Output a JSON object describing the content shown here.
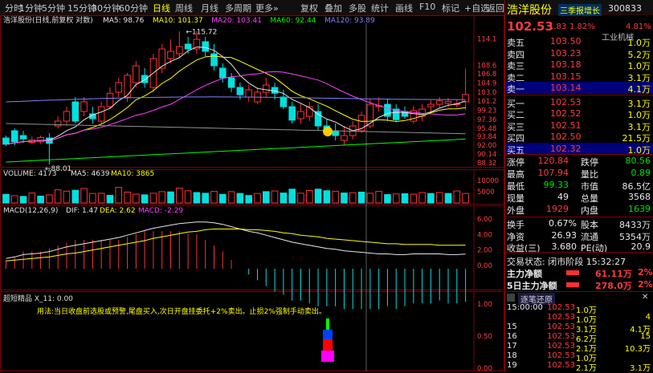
{
  "topbar": {
    "items": [
      "分时",
      "1分钟",
      "5分钟",
      "15分钟",
      "30分钟",
      "60分钟",
      "日线",
      "周线",
      "月线",
      "多周期",
      "更多»",
      "复权",
      "叠加",
      "多股",
      "统计",
      "画线",
      "F10",
      "标记",
      "+自选",
      "返回"
    ],
    "active": "日线"
  },
  "kline": {
    "title": "浩洋股份(日线,前复权 对数)",
    "ma": [
      {
        "label": "MA5: 98.76",
        "color": "#e8e8e8"
      },
      {
        "label": "MA10: 101.37",
        "color": "#ffff00"
      },
      {
        "label": "MA20: 103.41",
        "color": "#ff40ff"
      },
      {
        "label": "MA60: 92.44",
        "color": "#00ff00"
      },
      {
        "label": "MA120: 93.89",
        "color": "#8080ff"
      }
    ],
    "high_label": "115.72",
    "low_label": "88.01",
    "y_ticks": [
      "114.1",
      "108.6",
      "106.8",
      "104.9",
      "103.0",
      "101.2",
      "99.23",
      "97.36",
      "95.48",
      "93.84",
      "92.00",
      "90.14",
      "88.32"
    ],
    "ylim": [
      88.0,
      117.0
    ]
  },
  "volume": {
    "title": "VOLUME: 4173",
    "ma5": "MA5: 4639",
    "ma10": "MA10: 3865",
    "y_ticks": [
      "10000",
      "5000"
    ],
    "values": [
      3800,
      3200,
      2900,
      4400,
      3000,
      3600,
      5800,
      5200,
      5600,
      6400,
      4200,
      4300,
      3400,
      6900,
      4800,
      3900,
      3600,
      4300,
      5000,
      4900,
      6600,
      5400,
      4600,
      4300,
      5100,
      3800,
      5000,
      4200,
      3300,
      4200,
      5000,
      5300,
      4400,
      6100,
      4300,
      5500,
      6100,
      5400,
      5200,
      4400,
      4500,
      4800,
      4300,
      5100,
      3700,
      4000,
      4100,
      3900,
      4600,
      4200,
      4600,
      4200,
      5300,
      4200
    ],
    "colors": [
      "g",
      "r",
      "g",
      "r",
      "g",
      "r",
      "r",
      "r",
      "g",
      "r",
      "r",
      "r",
      "g",
      "r",
      "r",
      "r",
      "g",
      "r",
      "r",
      "g",
      "r",
      "r",
      "g",
      "g",
      "r",
      "g",
      "r",
      "g",
      "g",
      "r",
      "g",
      "r",
      "g",
      "g",
      "r",
      "r",
      "g",
      "g",
      "r",
      "g",
      "r",
      "g",
      "r",
      "r",
      "g",
      "r",
      "g",
      "r",
      "r",
      "g",
      "r",
      "g",
      "r",
      "r"
    ]
  },
  "macd": {
    "title": "MACD(12,26,9)",
    "dif": "DIF: 1.47",
    "dea": "DEA: 2.62",
    "macd": "MACD: -2.29",
    "y_ticks": [
      "6.00",
      "4.00",
      "2.00",
      "0.00"
    ],
    "dif_vals": [
      0.9,
      1.1,
      1.4,
      1.5,
      1.6,
      1.8,
      2.1,
      2.4,
      2.6,
      2.8,
      3.0,
      3.2,
      3.4,
      3.6,
      3.9,
      4.2,
      4.5,
      4.8,
      5.0,
      5.2,
      5.4,
      5.5,
      5.6,
      5.6,
      5.5,
      5.3,
      5.0,
      4.7,
      4.4,
      4.2,
      3.9,
      3.6,
      3.3,
      3.0,
      2.8,
      2.6,
      2.4,
      2.2,
      2.1,
      1.9,
      1.8,
      1.7,
      1.6,
      1.5,
      1.5,
      1.4,
      1.4,
      1.5,
      1.5,
      1.5,
      1.5,
      1.4,
      1.4,
      1.47
    ],
    "dea_vals": [
      0.6,
      0.7,
      0.8,
      0.9,
      1.0,
      1.1,
      1.3,
      1.5,
      1.6,
      1.8,
      2.0,
      2.2,
      2.4,
      2.6,
      2.8,
      3.0,
      3.2,
      3.5,
      3.7,
      3.9,
      4.1,
      4.3,
      4.4,
      4.6,
      4.7,
      4.7,
      4.7,
      4.7,
      4.6,
      4.6,
      4.5,
      4.4,
      4.2,
      4.1,
      3.9,
      3.8,
      3.7,
      3.5,
      3.4,
      3.3,
      3.2,
      3.1,
      3.0,
      2.9,
      2.8,
      2.8,
      2.7,
      2.7,
      2.7,
      2.7,
      2.6,
      2.6,
      2.6,
      2.62
    ]
  },
  "indicator": {
    "title": "超短精品  X_11: 0.00",
    "note": "用法:当日收盘前选股或预警,尾盘买入,次日开盘挂委托+2%卖出。止损2%强制手动卖出。",
    "y_ticks": [
      "1.00",
      "0.50",
      "0.00"
    ]
  },
  "quote": {
    "name": "浩洋股份",
    "tag": "三季报增长",
    "code": "300833",
    "price": "102.53",
    "change": "1.83",
    "pct": "1.82%",
    "amp": "4.81%",
    "sector": "工业机械",
    "asks": [
      {
        "label": "卖五",
        "price": "103.50",
        "vol": "1.0万"
      },
      {
        "label": "卖四",
        "price": "103.23",
        "vol": "5.2万"
      },
      {
        "label": "卖三",
        "price": "103.18",
        "vol": "1.0万"
      },
      {
        "label": "卖二",
        "price": "103.15",
        "vol": "3.1万"
      },
      {
        "label": "卖一",
        "price": "103.14",
        "vol": "4.1万"
      }
    ],
    "bids": [
      {
        "label": "买一",
        "price": "102.53",
        "vol": "3.1万"
      },
      {
        "label": "买二",
        "price": "102.52",
        "vol": "1.0万"
      },
      {
        "label": "买三",
        "price": "102.51",
        "vol": "3.1万"
      },
      {
        "label": "买四",
        "price": "102.50",
        "vol": "21.5万"
      },
      {
        "label": "买五",
        "price": "102.32",
        "vol": "1.0万"
      }
    ],
    "stats": [
      {
        "l1": "涨停",
        "v1": "120.84",
        "c1": "red",
        "l2": "跌停",
        "v2": "80.56",
        "c2": "grn"
      },
      {
        "l1": "最高",
        "v1": "107.94",
        "c1": "red",
        "l2": "量比",
        "v2": "0.89",
        "c2": "grn"
      },
      {
        "l1": "最低",
        "v1": "99.33",
        "c1": "grn",
        "l2": "市值",
        "v2": "86.5亿",
        "c2": "wht"
      },
      {
        "l1": "现量",
        "v1": "49",
        "c1": "wht",
        "l2": "总量",
        "v2": "3568",
        "c2": "wht"
      },
      {
        "l1": "外盘",
        "v1": "1929",
        "c1": "red",
        "l2": "内盘",
        "v2": "1639",
        "c2": "grn"
      }
    ],
    "stats2": [
      {
        "l1": "换手",
        "v1": "0.67%",
        "l2": "股本",
        "v2": "8433万"
      },
      {
        "l1": "净资",
        "v1": "26.93",
        "l2": "流通",
        "v2": "5354万"
      },
      {
        "l1": "收益(三)",
        "v1": "3.680",
        "l2": "PE(动)",
        "v2": "20.9"
      }
    ],
    "status": "交易状态: 闭市阶段 15:32:27",
    "flow1_label": "主力净额",
    "flow1_val": "61.11万",
    "flow1_pct": "2%",
    "flow2_label": "5日主力净额",
    "flow2_val": "278.0万",
    "flow2_pct": "2%",
    "ticks_title": "逐笔还原",
    "ticks": [
      {
        "t": "15:00:00",
        "p": "102.53",
        "v": "1.0万",
        "x": ""
      },
      {
        "t": "",
        "p": "102.53",
        "v": "1.0万",
        "x": "4"
      },
      {
        "t": "15",
        "p": "102.53",
        "v": "3.1万",
        "x": "4.1万"
      },
      {
        "t": "16",
        "p": "102.53",
        "v": "6.2万",
        "x": "15"
      },
      {
        "t": "17",
        "p": "102.53",
        "v": "2.1万",
        "x": "10.3万"
      },
      {
        "t": "18",
        "p": "102.53",
        "v": "1.0万",
        "x": ""
      },
      {
        "t": "19",
        "p": "102.53",
        "v": "2.1万",
        "x": "3.1万"
      }
    ]
  }
}
